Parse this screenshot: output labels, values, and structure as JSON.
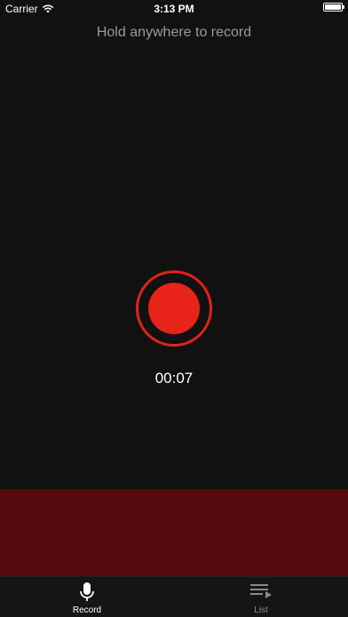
{
  "status_bar": {
    "carrier": "Carrier",
    "time": "3:13 PM",
    "battery_level": 1.0
  },
  "hint": "Hold anywhere to record",
  "recorder": {
    "timer": "00:07",
    "accent_color": "#e8241a",
    "panel_color": "#540a0c"
  },
  "tabs": [
    {
      "label": "Record",
      "icon": "microphone-icon",
      "active": true
    },
    {
      "label": "List",
      "icon": "list-icon",
      "active": false
    }
  ]
}
